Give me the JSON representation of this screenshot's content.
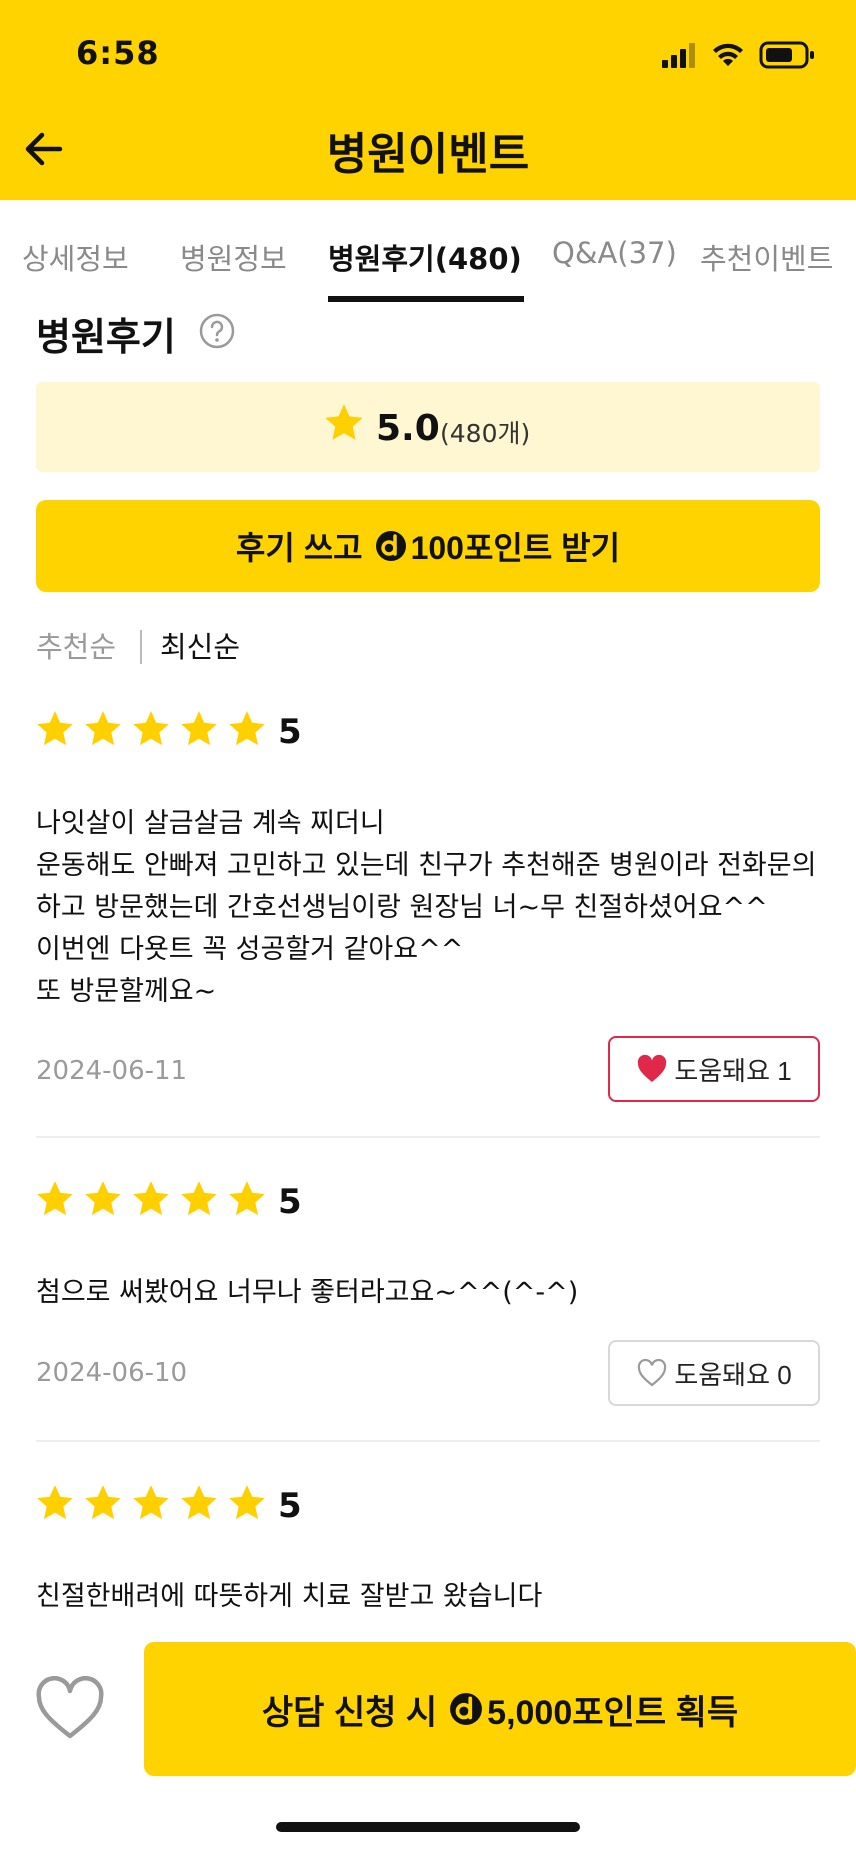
{
  "status_bar": {
    "time": "6:58"
  },
  "header": {
    "title": "병원이벤트"
  },
  "tabs": [
    {
      "label": "상세정보"
    },
    {
      "label": "병원정보"
    },
    {
      "label": "병원후기(480)"
    },
    {
      "label": "Q&A(37)"
    },
    {
      "label": "추천이벤트"
    }
  ],
  "reviews_section": {
    "title": "병원후기",
    "score": "5.0",
    "count": "(480개)",
    "write_prefix": "후기 쓰고",
    "write_suffix": "100포인트 받기",
    "sort_recommended": "추천순",
    "sort_latest": "최신순"
  },
  "reviews": [
    {
      "rating": "5",
      "lines": [
        "나잇살이 살금살금 계속 찌더니",
        "운동해도 안빠져 고민하고 있는데 친구가 추천해준 병원이라 전화문의",
        "하고 방문했는데 간호선생님이랑 원장님 너~무 친절하셨어요^^",
        "이번엔 다욧트 꼭 성공할거 같아요^^",
        "또 방문할께요~"
      ],
      "date": "2024-06-11",
      "helpful": "도움돼요 1"
    },
    {
      "rating": "5",
      "lines": [
        "첨으로 써봤어요 너무나 좋터라고요~^^(^-^)"
      ],
      "date": "2024-06-10",
      "helpful": "도움돼요 0"
    },
    {
      "rating": "5",
      "lines": [
        "친절한배려에 따뜻하게 치료 잘받고 왔습니다"
      ]
    }
  ],
  "bottom": {
    "consult_prefix": "상담 신청 시",
    "consult_suffix": "5,000포인트 획득"
  },
  "colors": {
    "brand": "#FFD300",
    "highlight_bg": "#FFF7D2",
    "heart_active": "#E0284A",
    "star": "#FFD000"
  },
  "icons": [
    "back-arrow-icon",
    "help-icon",
    "star-icon",
    "point-coin-icon",
    "heart-icon",
    "signal-icon",
    "wifi-icon",
    "battery-icon"
  ]
}
